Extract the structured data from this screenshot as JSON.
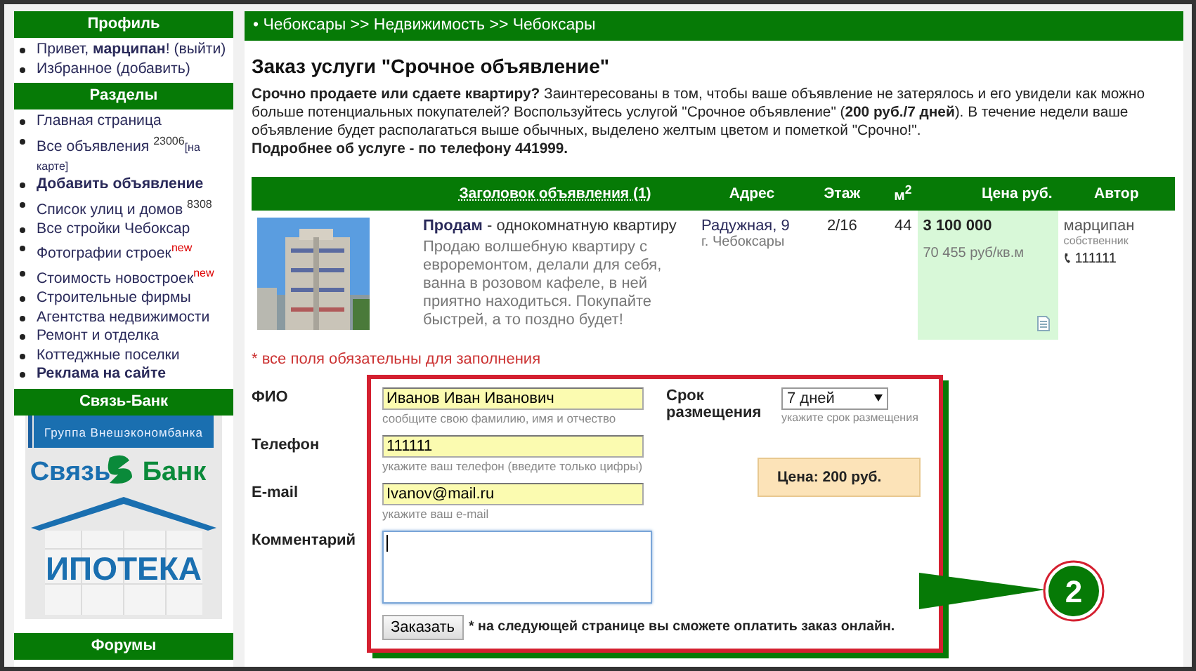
{
  "sidebar": {
    "sections": [
      {
        "kind": "links",
        "title": "Профиль",
        "items": [
          {
            "label": "Привет, **марципан**! (выйти)",
            "bold": false
          },
          {
            "label": "Избранное (добавить)",
            "bold": false
          }
        ]
      },
      {
        "kind": "links",
        "title": "Разделы",
        "items": [
          {
            "label": "Главная страница",
            "bold": false
          },
          {
            "label": "Все объявления ",
            "bold": false,
            "badge": "23006",
            "kind": "count",
            "extra": "[на карте]"
          },
          {
            "label": "Добавить объявление",
            "bold": true
          },
          {
            "label": "Список улиц и домов ",
            "bold": false,
            "badge": "8308",
            "kind": "count"
          },
          {
            "label": "Все стройки Чебоксар",
            "bold": false
          },
          {
            "label": "Фотографии строек",
            "bold": false,
            "badge": "new",
            "kind": "new"
          },
          {
            "label": "Стоимость новостроек",
            "bold": false,
            "badge": "new",
            "kind": "new"
          },
          {
            "label": "Строительные фирмы",
            "bold": false
          },
          {
            "label": "Агентства недвижимости",
            "bold": false
          },
          {
            "label": "Ремонт и отделка",
            "bold": false
          },
          {
            "label": "Коттеджные поселки",
            "bold": false
          },
          {
            "label": "Реклама на сайте",
            "bold": true
          }
        ]
      },
      {
        "kind": "banner",
        "title": "Связь-Банк",
        "group": "Группа Внешэкономбанка",
        "brand_left": "Связь",
        "brand_right": "Банк",
        "product": "ИПОТЕКА"
      },
      {
        "kind": "header",
        "title": "Форумы"
      }
    ]
  },
  "breadcrumb": "• Чебоксары >> Недвижимость >> Чебоксары",
  "page_title": "Заказ услуги \"Срочное объявление\"",
  "intro": "**Срочно продаете или сдаете квартиру?** Заинтересованы в том, чтобы ваше объявление не затерялось и его увидели как можно больше потенциальных покупателей? Воспользуйтесь услугой \"Срочное объявление\" (**200 руб./7 дней**). В течение недели ваше объявление будет располагаться выше обычных, выделено желтым цветом и пометкой \"Срочно!\".",
  "intro_contact": "Подробнее об услуге - по телефону 441999.",
  "table": {
    "columns": [
      "Заголовок объявления (1)",
      "Адрес",
      "Этаж",
      "м$^{2}$",
      "Цена руб.",
      "Автор"
    ],
    "rows": [
      {
        "kind": "picture",
        "title": "**Продам** - однокомнатную квартиру",
        "description": "Продаю волшебную квартиру с евроремонтом, делали для себя, ванна в розовом кафеле, в ней приятно находиться. Покупайте быстрей, а то поздно будет!",
        "address": "Радужная, 9",
        "city": "г. Чебоксары",
        "floor": "2/16",
        "area": "44",
        "price": "3 100 000",
        "price_per_m2": "70 455 руб/кв.м",
        "author": "марципан",
        "author_type": "собственник",
        "phone": "111111"
      }
    ]
  },
  "required_note": "* все поля обязательны для заполнения",
  "form": {
    "fields": [
      {
        "kind": "input",
        "label": "ФИО",
        "value": "Иванов Иван Иванович",
        "hint": "сообщите свою фамилию, имя и отчество",
        "focused": false
      },
      {
        "kind": "input",
        "label": "Телефон",
        "value": "111111",
        "hint": "укажите ваш телефон (введите только цифры)",
        "focused": false
      },
      {
        "kind": "input",
        "label": "E-mail",
        "value": "Ivanov@mail.ru",
        "hint": "укажите ваш e-mail",
        "focused": false
      },
      {
        "kind": "textarea",
        "label": "Комментарий",
        "focused": true
      }
    ],
    "term": {
      "label": "Срок размещения",
      "value": "7 дней",
      "hint": "укажите срок размещения"
    },
    "price": "Цена: 200 руб.",
    "submit": "Заказать",
    "submit_note": "* на следующей странице вы сможете оплатить заказ онлайн."
  },
  "callout": "2"
}
